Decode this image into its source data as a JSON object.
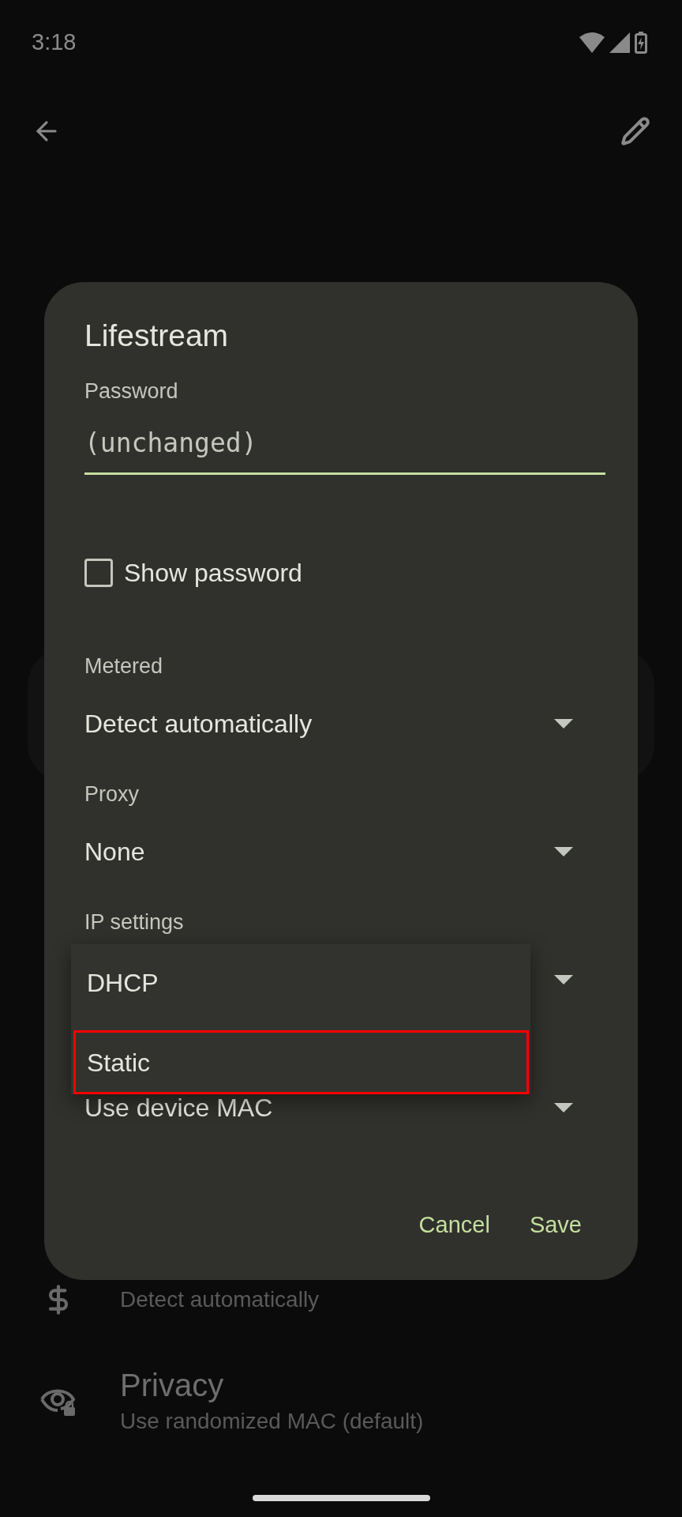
{
  "status_bar": {
    "time": "3:18"
  },
  "dialog": {
    "title": "Lifestream",
    "password": {
      "label": "Password",
      "placeholder": "(unchanged)"
    },
    "show_password": {
      "label": "Show password",
      "checked": false
    },
    "fields": [
      {
        "label": "Metered",
        "value": "Detect automatically"
      },
      {
        "label": "Proxy",
        "value": "None"
      },
      {
        "label": "IP settings"
      },
      {
        "value": "Use device MAC"
      }
    ],
    "dropdown_menu": [
      {
        "label": "DHCP",
        "highlighted": false
      },
      {
        "label": "Static",
        "highlighted": true
      }
    ],
    "buttons": [
      {
        "label": "Cancel"
      },
      {
        "label": "Save"
      }
    ]
  },
  "background_list": [
    {
      "kind": "dollar",
      "subtitle": "Detect automatically"
    },
    {
      "kind": "privacy",
      "title": "Privacy",
      "subtitle": "Use randomized MAC (default)"
    }
  ]
}
